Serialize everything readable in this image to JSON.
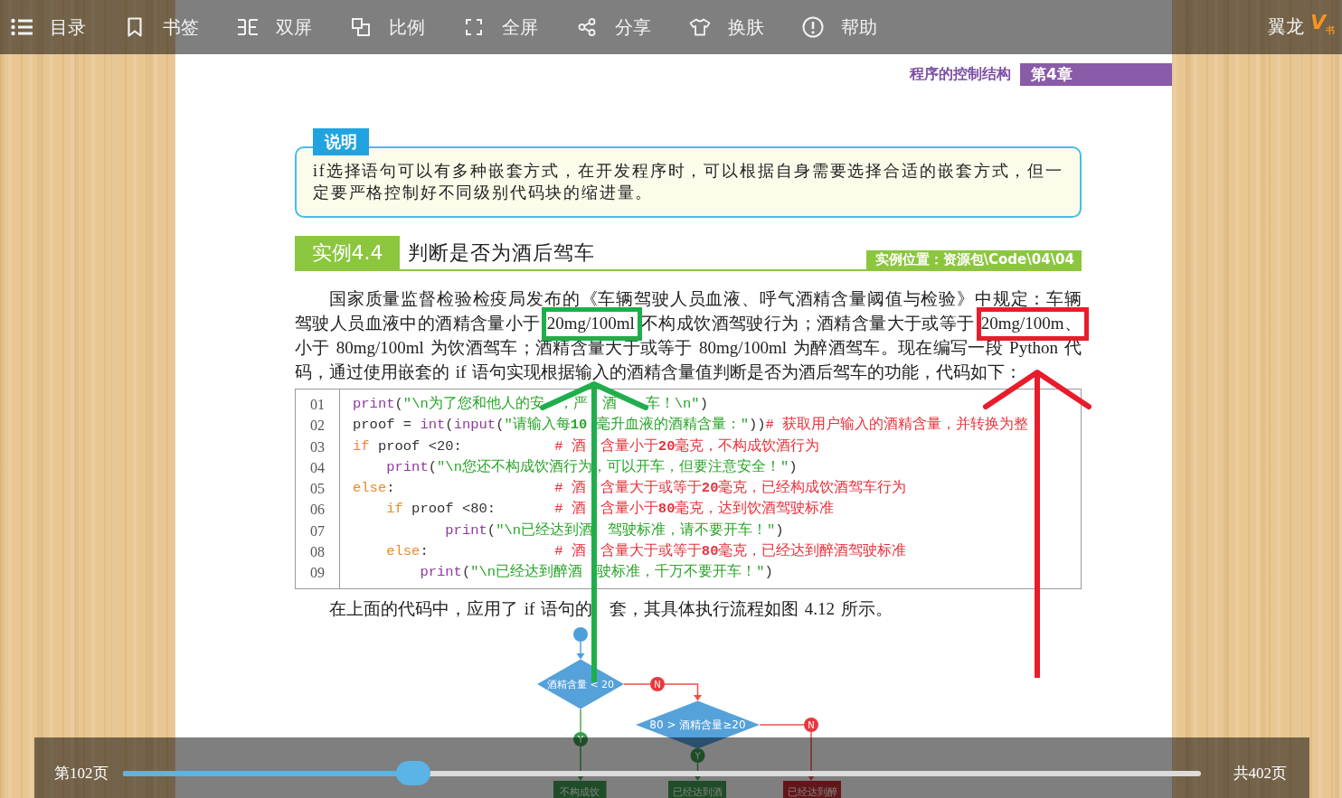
{
  "toolbar": {
    "items": [
      {
        "label": "目录"
      },
      {
        "label": "书签"
      },
      {
        "label": "双屏"
      },
      {
        "label": "比例"
      },
      {
        "label": "全屏"
      },
      {
        "label": "分享"
      },
      {
        "label": "换肤"
      },
      {
        "label": "帮助"
      }
    ],
    "brand": "翼龙",
    "logo": "V$_{书}$"
  },
  "page": {
    "header": {
      "section": "程序的控制结构",
      "chapter": "第4章"
    },
    "note": {
      "tag": "说明",
      "lines": [
        "if选择语句可以有多种嵌套方式，在开发程序时，可以根据自身需要选择合适的嵌套方式，但一",
        "定要严格控制好不同级别代码块的缩进量。"
      ]
    },
    "example": {
      "number": "实例4.4",
      "title": "判断是否为酒后驾车",
      "location": "实例位置：资源包\\Code\\04\\04"
    },
    "intro": {
      "lines": [
        "国家质量监督检验检疫局发布的《车辆驾驶人员血液、呼气酒精含量阈值与检验》中规定：车辆",
        "驾驶人员血液中的酒精含量小于 20mg/100ml 不构成饮酒驾驶行为；酒精含量大于或等于 20mg/100m、",
        "小于 80mg/100ml 为饮酒驾车；酒精含量大于或等于 80mg/100ml 为醉酒驾车。现在编写一段 Python 代",
        "码，通过使用嵌套的 if 语句实现根据输入的酒精含量值判断是否为酒后驾车的功能，代码如下："
      ]
    },
    "code": {
      "lines": [
        {
          "number": "01",
          "tokens": [
            {
              "kind": "func",
              "text": "print"
            },
            {
              "kind": "plain",
              "text": "("
            },
            {
              "kind": "string",
              "text": "\"\\n为了您和他人的安　，严　酒　　车！\\n\""
            },
            {
              "kind": "plain",
              "text": ")"
            }
          ]
        },
        {
          "number": "02",
          "tokens": [
            {
              "kind": "plain",
              "text": "proof = "
            },
            {
              "kind": "func",
              "text": "int"
            },
            {
              "kind": "plain",
              "text": "("
            },
            {
              "kind": "func",
              "text": "input"
            },
            {
              "kind": "plain",
              "text": "("
            },
            {
              "kind": "string",
              "text": "\"请输入每**10** 毫升血液的酒精含量：\""
            },
            {
              "kind": "plain",
              "text": "))"
            },
            {
              "kind": "comment",
              "text": "# 获取用户输入的酒精含量，并转换为整"
            }
          ]
        },
        {
          "number": "03",
          "tokens": [
            {
              "kind": "keyword",
              "text": "if"
            },
            {
              "kind": "plain",
              "text": " proof <20:           "
            },
            {
              "kind": "comment",
              "text": "# 酒　含量小于**20**毫克，不构成饮酒行为"
            }
          ]
        },
        {
          "number": "04",
          "tokens": [
            {
              "kind": "func",
              "text": "    print"
            },
            {
              "kind": "plain",
              "text": "("
            },
            {
              "kind": "string",
              "text": "\"\\n您还不构成饮酒行为，可以开车，但要注意安全！\""
            },
            {
              "kind": "plain",
              "text": ")"
            }
          ]
        },
        {
          "number": "05",
          "tokens": [
            {
              "kind": "keyword",
              "text": "else"
            },
            {
              "kind": "plain",
              "text": ":                   "
            },
            {
              "kind": "comment",
              "text": "# 酒　含量大于或等于**20**毫克，已经构成饮酒驾车行为"
            }
          ]
        },
        {
          "number": "06",
          "tokens": [
            {
              "kind": "keyword",
              "text": "    if"
            },
            {
              "kind": "plain",
              "text": " proof <80:       "
            },
            {
              "kind": "comment",
              "text": "# 酒　含量小于**80**毫克，达到饮酒驾驶标准"
            }
          ]
        },
        {
          "number": "07",
          "tokens": [
            {
              "kind": "func",
              "text": "           print"
            },
            {
              "kind": "plain",
              "text": "("
            },
            {
              "kind": "string",
              "text": "\"\\n已经达到酒　驾驶标准，请不要开车！\""
            },
            {
              "kind": "plain",
              "text": ")"
            }
          ]
        },
        {
          "number": "08",
          "tokens": [
            {
              "kind": "keyword",
              "text": "    else"
            },
            {
              "kind": "plain",
              "text": ":               "
            },
            {
              "kind": "comment",
              "text": "# 酒　含量大于或等于**80**毫克，已经达到醉酒驾驶标准"
            }
          ]
        },
        {
          "number": "09",
          "tokens": [
            {
              "kind": "func",
              "text": "        print"
            },
            {
              "kind": "plain",
              "text": "("
            },
            {
              "kind": "string",
              "text": "\"\\n已经达到醉酒　驶标准，千万不要开车！\""
            },
            {
              "kind": "plain",
              "text": ")"
            }
          ]
        }
      ]
    },
    "summary": "在上面的代码中，应用了 if 语句的　套，其具体执行流程如图 4.12 所示。",
    "flowchart": {
      "decisions": [
        {
          "text": "酒精含量 < 20",
          "no_label": "N",
          "yes_label": "Y"
        },
        {
          "text": "80 > 酒精含量≥20",
          "no_label": "N",
          "yes_label": "Y"
        }
      ],
      "results": [
        {
          "text": "不构成饮",
          "kind": "yes"
        },
        {
          "text": "已经达到酒",
          "kind": "yes"
        },
        {
          "text": "已经达到醉",
          "kind": "no"
        }
      ]
    }
  },
  "annotations": [
    {
      "kind": "box",
      "color": "#1fae4b"
    },
    {
      "kind": "arrow",
      "color": "#1fae4b"
    },
    {
      "kind": "box",
      "color": "#e81c2b"
    },
    {
      "kind": "arrow",
      "color": "#e81c2b"
    }
  ],
  "page_slider": {
    "current": "第102页",
    "level": 0.27,
    "total": "共402页"
  }
}
